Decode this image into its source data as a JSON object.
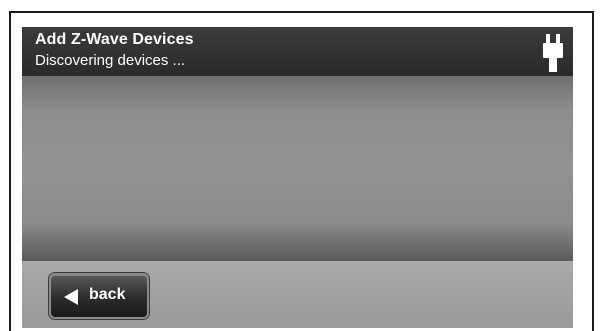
{
  "header": {
    "title": "Add Z-Wave Devices",
    "subtitle": "Discovering devices ...",
    "status_icon": "power-plug-icon"
  },
  "footer": {
    "back_label": "back",
    "back_icon": "left-arrow-icon"
  },
  "colors": {
    "header_bg": "#2e2e2e",
    "content_bg": "#8d8d8d",
    "footer_bg": "#a3a3a3",
    "button_bg": "#2b2b2b",
    "text": "#ffffff"
  }
}
